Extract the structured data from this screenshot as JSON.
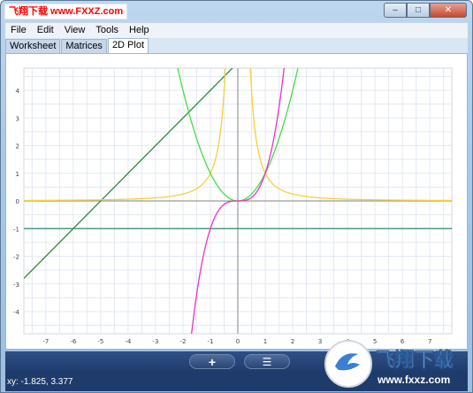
{
  "window": {
    "title_watermark": "飞翔下载 www.FXXZ.com",
    "controls": {
      "minimize": "–",
      "maximize": "□",
      "close": "✕"
    }
  },
  "menu": {
    "items": [
      "File",
      "Edit",
      "View",
      "Tools",
      "Help"
    ]
  },
  "tabs": [
    {
      "label": "Worksheet",
      "active": false
    },
    {
      "label": "Matrices",
      "active": false
    },
    {
      "label": "2D Plot",
      "active": true
    }
  ],
  "toolbar": {
    "add_label": "+",
    "menu_label": "☰"
  },
  "status": {
    "text": "xy: -1.825, 3.377"
  },
  "watermark_bottom": {
    "brand": "飞翔下载",
    "url": "www.fxxz.com"
  },
  "chart_data": {
    "type": "line",
    "title": "",
    "xlabel": "",
    "ylabel": "",
    "xlim": [
      -7.8,
      7.8
    ],
    "ylim": [
      -4.8,
      4.8
    ],
    "grid": true,
    "x_ticks": [
      -7,
      -6,
      -5,
      -4,
      -3,
      -2,
      -1,
      0,
      1,
      2,
      3,
      4,
      5,
      6,
      7
    ],
    "y_ticks": [
      -4,
      -3,
      -2,
      -1,
      0,
      1,
      2,
      3,
      4
    ],
    "series": [
      {
        "shape": "line y = x + 5",
        "color": "#2e8b3e",
        "points": [
          [
            -7.8,
            -2.8
          ],
          [
            -0.3,
            4.7
          ]
        ]
      },
      {
        "shape": "horizontal line y = -1",
        "color": "#2a8a6a",
        "points": [
          [
            -7.8,
            -1
          ],
          [
            7.8,
            -1
          ]
        ]
      },
      {
        "shape": "cubic y = x^3",
        "color": "#ee30c8",
        "points": [
          [
            -1.7,
            -4.9
          ],
          [
            -1.0,
            -1.0
          ],
          [
            0,
            0
          ],
          [
            1.0,
            1.0
          ],
          [
            1.7,
            4.9
          ]
        ]
      },
      {
        "shape": "parabola y = x^2",
        "color": "#44dd44",
        "points": [
          [
            -2.2,
            4.8
          ],
          [
            -1,
            1
          ],
          [
            0,
            0
          ],
          [
            1,
            1
          ],
          [
            2.2,
            4.8
          ]
        ]
      },
      {
        "shape": "y = 1/x^2",
        "color": "#f7cf3a",
        "points": [
          [
            -7.8,
            0.016
          ],
          [
            -1,
            1
          ],
          [
            -0.46,
            4.7
          ],
          [
            0.46,
            4.7
          ],
          [
            1,
            1
          ],
          [
            7.8,
            0.016
          ]
        ]
      }
    ]
  }
}
